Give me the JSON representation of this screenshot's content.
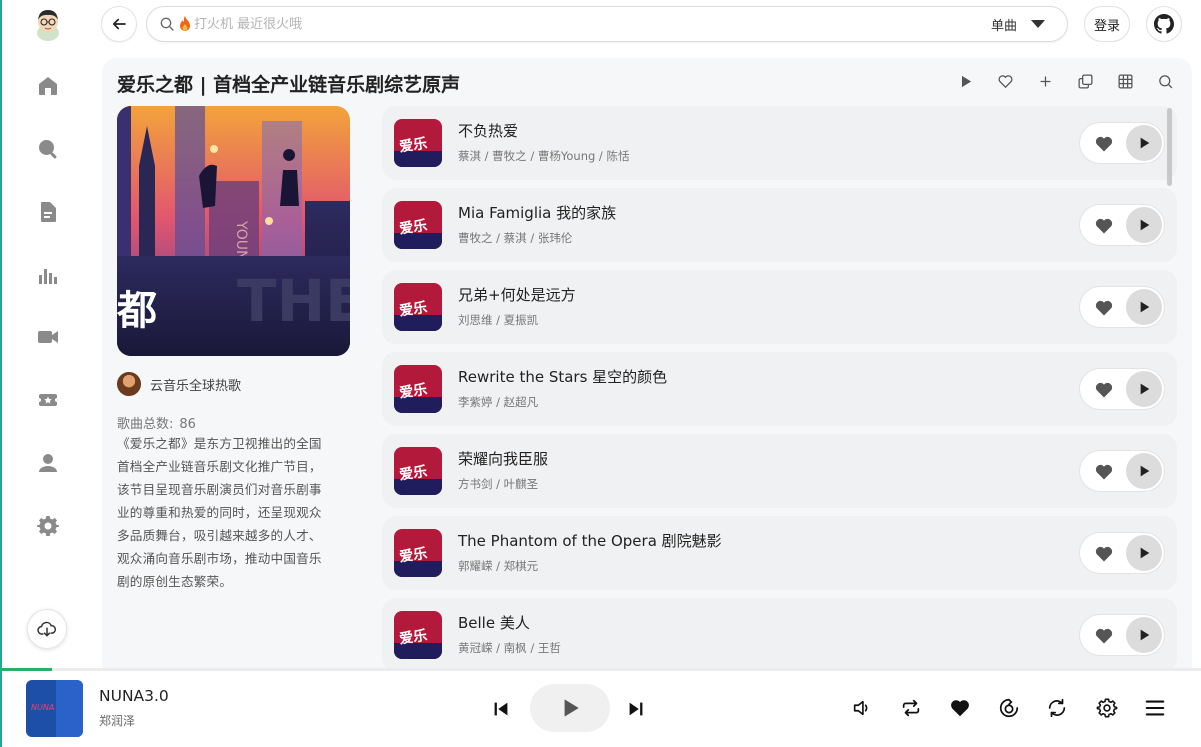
{
  "search": {
    "placeholder": "打火机 最近很火哦",
    "type_label": "单曲"
  },
  "header": {
    "login_label": "登录"
  },
  "sidebar": {
    "items": [
      {
        "icon": "home-icon"
      },
      {
        "icon": "search-icon"
      },
      {
        "icon": "document-icon"
      },
      {
        "icon": "chart-icon"
      },
      {
        "icon": "video-icon"
      },
      {
        "icon": "star-box-icon"
      },
      {
        "icon": "user-icon"
      },
      {
        "icon": "gear-icon"
      }
    ]
  },
  "playlist": {
    "title": "爱乐之都 | 首档全产业链音乐剧综艺原声",
    "cover_text": "都",
    "creator": "云音乐全球热歌",
    "count_label": "歌曲总数:",
    "count": "86",
    "description": "《爱乐之都》是东方卫视推出的全国首档全产业链音乐剧文化推广节目，该节目呈现音乐剧演员们对音乐剧事业的尊重和热爱的同时，还呈现观众多品质舞台，吸引越来越多的人才、观众涌向音乐剧市场，推动中国音乐剧的原创生态繁荣。"
  },
  "songs": [
    {
      "name": "不负热爱",
      "artists": "蔡淇 / 曹牧之 / 曹杨Young / 陈恬"
    },
    {
      "name": "Mia Famiglia 我的家族",
      "artists": "曹牧之 / 蔡淇 / 张玮伦"
    },
    {
      "name": "兄弟+何处是远方",
      "artists": "刘思维 / 夏振凯"
    },
    {
      "name": "Rewrite the Stars 星空的颜色",
      "artists": "李紫婷 / 赵超凡"
    },
    {
      "name": "荣耀向我臣服",
      "artists": "方书剑 / 叶麒圣"
    },
    {
      "name": "The Phantom of the Opera 剧院魅影",
      "artists": "郭耀嵘 / 郑棋元"
    },
    {
      "name": "Belle 美人",
      "artists": "黄冠嵘 / 南枫 / 王哲"
    }
  ],
  "player": {
    "song": "NUNA3.0",
    "artist": "郑润泽",
    "progress": 0.043
  },
  "colors": {
    "accent": "#26a69a",
    "progress": "#25b363"
  }
}
